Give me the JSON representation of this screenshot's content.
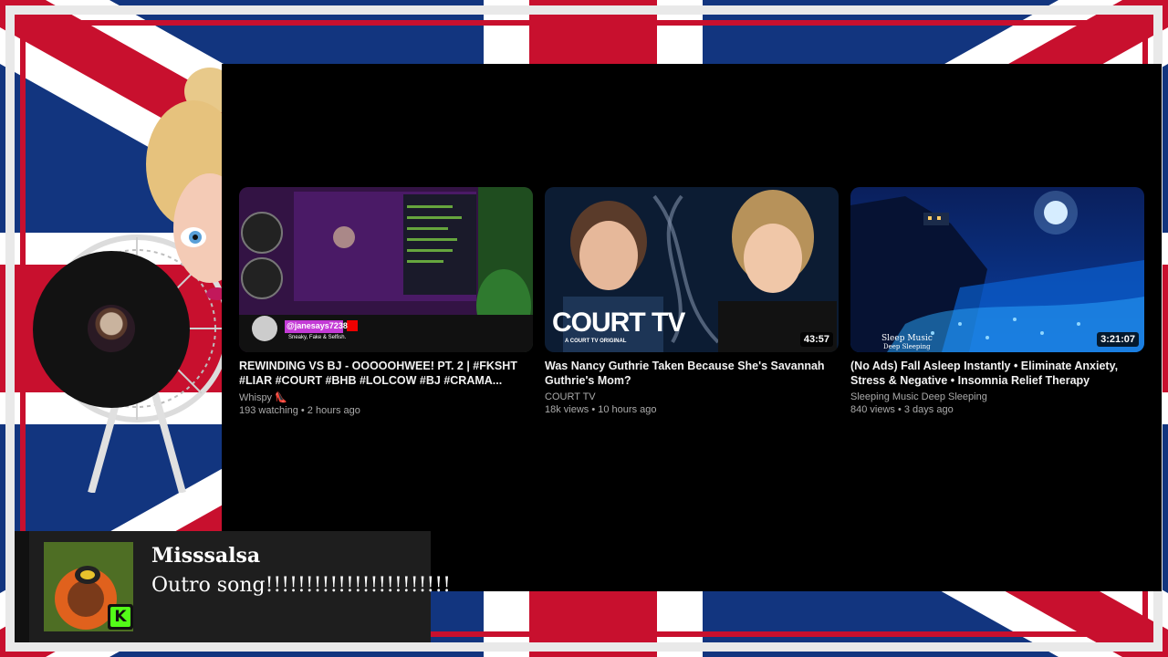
{
  "videos": [
    {
      "title": "REWINDING VS BJ - OOOOOHWEE! PT. 2 | #FKSHT #LIAR #COURT #BHB #LOLCOW #BJ #CRAMA...",
      "channel": "Whispy",
      "channel_badge": "👠",
      "meta": "193 watching • 2 hours ago",
      "duration": "",
      "thumb_overlay_text": "@janesays7238",
      "thumb_overlay_sub": "Sneaky, Fake & Selfish."
    },
    {
      "title": "Was Nancy Guthrie Taken Because She's Savannah Guthrie's Mom?",
      "channel": "COURT TV",
      "meta": "18k views • 10 hours ago",
      "duration": "43:57",
      "thumb_logo": "COURT TV",
      "thumb_logo_sub": "A COURT TV ORIGINAL"
    },
    {
      "title": "(No Ads) Fall Asleep Instantly • Eliminate Anxiety, Stress & Negative • Insomnia Relief Therapy",
      "channel": "Sleeping Music Deep Sleeping",
      "meta": "840 views • 3 days ago",
      "duration": "3:21:07",
      "thumb_logo": "Sleep Music",
      "thumb_logo_sub": "Deep Sleeping"
    }
  ],
  "chat": {
    "username": "Misssalsa",
    "message": "Outro song!!!!!!!!!!!!!!!!!!!!!!!",
    "platform_badge": "K"
  },
  "colors": {
    "flag_blue": "#0d2a6b",
    "flag_red": "#c8102e",
    "kick_green": "#53fc18"
  }
}
